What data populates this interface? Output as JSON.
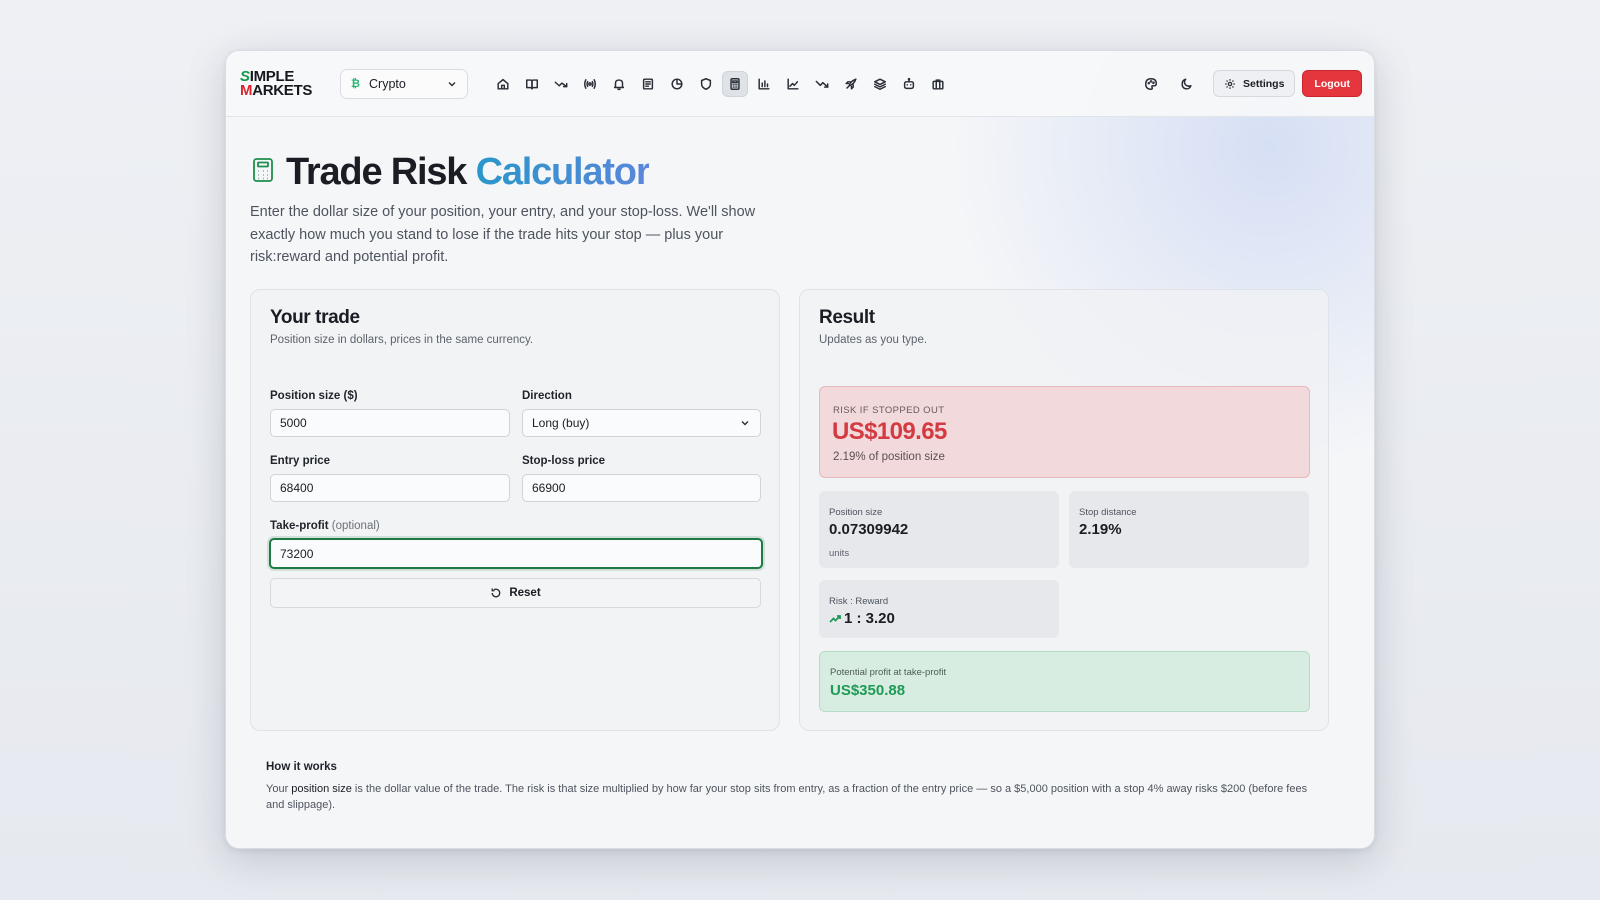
{
  "brand": {
    "logo_line1_initial": "S",
    "logo_line1_rest": "IMPLE",
    "logo_line2_initial": "M",
    "logo_line2_rest": "ARKETS"
  },
  "header": {
    "market_select": {
      "icon_text": "₿",
      "value": "Crypto"
    },
    "nav_icons": [
      "home-icon",
      "book-icon",
      "trend-icon",
      "broadcast-icon",
      "bell-icon",
      "newspaper-icon",
      "pie-chart-icon",
      "shield-icon",
      "calculator-icon",
      "bar-chart-icon",
      "line-chart-icon",
      "trending-down-icon",
      "rocket-icon",
      "layers-icon",
      "robot-icon",
      "briefcase-icon"
    ],
    "active_nav": "calculator-icon",
    "settings_label": "Settings",
    "logout_label": "Logout"
  },
  "page": {
    "title_part1": "Trade Risk",
    "title_part2": "Calculator",
    "intro": "Enter the dollar size of your position, your entry, and your stop-loss. We'll show exactly how much you stand to lose if the trade hits your stop — plus your risk:reward and potential profit."
  },
  "trade_card": {
    "title": "Your trade",
    "subtitle": "Position size in dollars, prices in the same currency.",
    "position_size_label": "Position size ($)",
    "position_size_value": "5000",
    "direction_label": "Direction",
    "direction_value": "Long (buy)",
    "entry_label": "Entry price",
    "entry_value": "68400",
    "stop_label": "Stop-loss price",
    "stop_value": "66900",
    "tp_label": "Take-profit",
    "tp_optional": "(optional)",
    "tp_value": "73200",
    "reset_label": "Reset"
  },
  "result_card": {
    "title": "Result",
    "subtitle": "Updates as you type.",
    "risk_label": "RISK IF STOPPED OUT",
    "risk_value": "US$109.65",
    "risk_pct": "2.19% of position size",
    "position_size_label": "Position size",
    "position_size_value": "0.07309942",
    "position_size_unit": "units",
    "stop_distance_label": "Stop distance",
    "stop_distance_value": "2.19%",
    "rr_label": "Risk : Reward",
    "rr_value": "1 : 3.20",
    "profit_label": "Potential profit at take-profit",
    "profit_value": "US$350.88"
  },
  "how_it_works": {
    "title": "How it works",
    "body_pre": "Your ",
    "body_em": "position size",
    "body_post": " is the dollar value of the trade. The risk is that size multiplied by how far your stop sits from entry, as a fraction of the entry price — so a $5,000 position with a stop 4% away risks $200 (before fees and slippage)."
  },
  "colors": {
    "accent_green": "#1e9a55",
    "danger_red": "#e5363d",
    "title_gradient_start": "#2897c9",
    "title_gradient_end": "#5b86da"
  }
}
